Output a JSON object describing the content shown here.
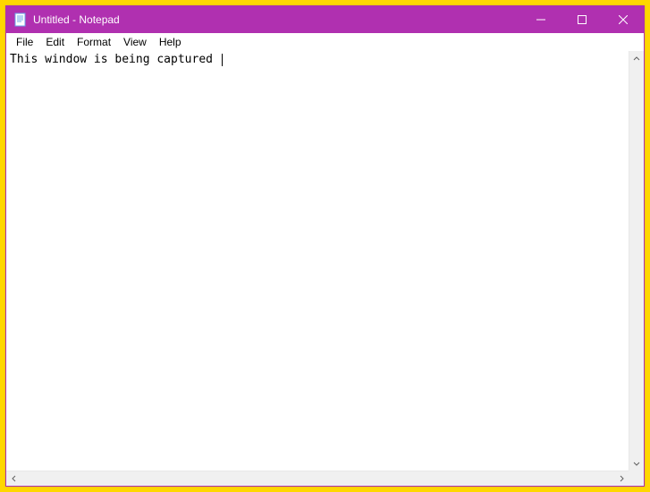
{
  "window": {
    "title": "Untitled - Notepad"
  },
  "menu": {
    "items": [
      "File",
      "Edit",
      "Format",
      "View",
      "Help"
    ]
  },
  "editor": {
    "content": "This window is being captured "
  },
  "colors": {
    "titlebar": "#b030b0",
    "capture_border": "#ffd700"
  }
}
